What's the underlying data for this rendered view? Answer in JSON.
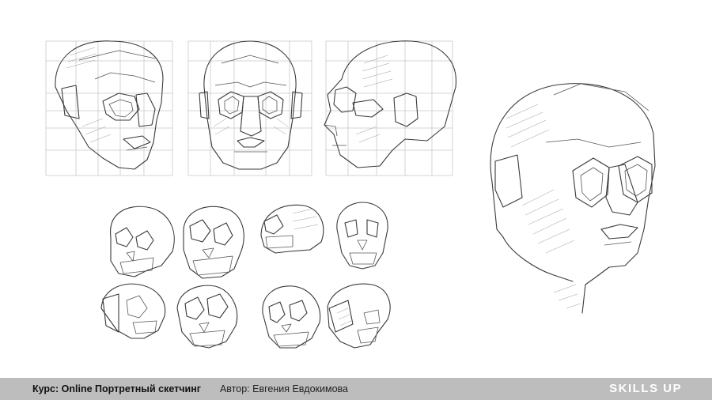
{
  "footer": {
    "course": "Курс: Online Портретный скетчинг",
    "author": "Автор: Евгения Евдокимова",
    "brand": "SKILLS UP"
  }
}
